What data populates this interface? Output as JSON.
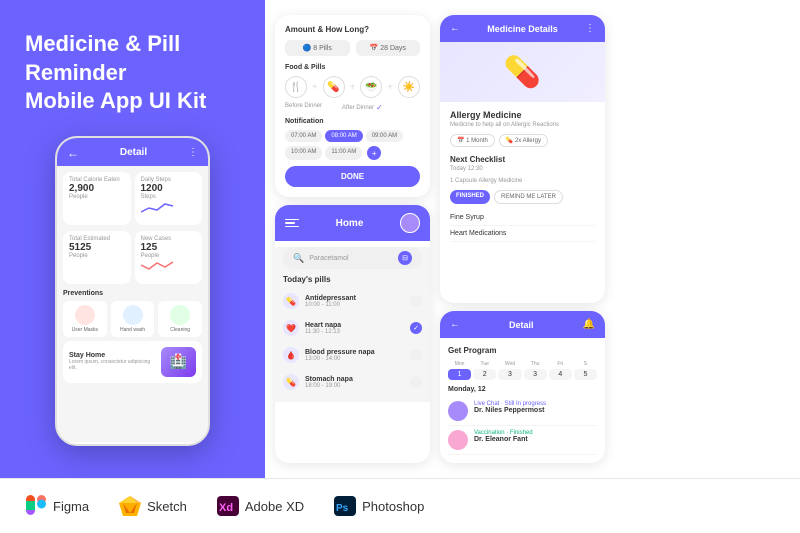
{
  "left": {
    "title": "Medicine & Pill Reminder\nMobile App UI Kit",
    "phone": {
      "header": "Detail",
      "stats": [
        {
          "label": "Total Calorie Eaten",
          "value": "2,900",
          "unit": "People"
        },
        {
          "label": "Daily Steps",
          "value": "1200",
          "unit": "Steps"
        }
      ],
      "stats2": [
        {
          "label": "Total Estimated",
          "value": "5125",
          "unit": "People"
        },
        {
          "label": "New Cases",
          "value": "125",
          "unit": "People"
        }
      ],
      "preventions_title": "Preventions",
      "preventions": [
        {
          "label": "User Masks"
        },
        {
          "label": "Hand wash"
        },
        {
          "label": "Cleaning"
        }
      ],
      "stay_home_title": "Stay Home",
      "stay_home_desc": "Lorem ipsum, consectetur adipiscing elit."
    }
  },
  "middle": {
    "amount_screen": {
      "title": "Amount & How Long?",
      "pill_amount": "8 Pills",
      "duration": "28 Days",
      "food_section": "Food & Pills",
      "before_dinner": "Before Dinner",
      "after_dinner": "After Dinner",
      "notification": "Notification",
      "times": [
        "07:00 AM",
        "08:00 AM",
        "09:00 AM",
        "10:00 AM",
        "11:00 AM"
      ],
      "done_btn": "DONE"
    },
    "home_screen": {
      "title": "Home",
      "search_placeholder": "Paracetamol",
      "today_pills": "Today's pills",
      "pills": [
        {
          "name": "Antidepressant",
          "time": "10:00 - 11:00",
          "checked": false
        },
        {
          "name": "Heart napa",
          "time": "11:30 - 12:13",
          "checked": true
        },
        {
          "name": "Blood pressure napa",
          "time": "13:00 - 14:00",
          "checked": false
        },
        {
          "name": "Stomach napa",
          "time": "18:00 - 19:00",
          "checked": false
        }
      ]
    }
  },
  "right": {
    "medicine_details": {
      "title": "Medicine Details",
      "image_emoji": "💊",
      "allergy_title": "Allergy Medicine",
      "allergy_desc": "Medicine to help all on Allergic Reactions",
      "tags": [
        "1 Month",
        "2x Allergy"
      ],
      "next_checklist": "Next Checklist",
      "time": "Today 12:30",
      "person": "1 Capsule Allergy Medicine",
      "btn_finished": "FINISHED",
      "btn_remind": "REMIND ME LATER",
      "items": [
        "Fine Syrup",
        "Heart Medications"
      ]
    },
    "detail_screen": {
      "title": "Detail",
      "get_program": "Get Program",
      "days": [
        {
          "label": "Mon",
          "num": "1",
          "active": true
        },
        {
          "label": "Tue",
          "num": "2",
          "active": false
        },
        {
          "label": "Wed",
          "num": "3",
          "active": false
        },
        {
          "label": "Thu",
          "num": "3",
          "active": false
        },
        {
          "label": "Fri",
          "num": "4",
          "active": false
        },
        {
          "label": "S",
          "num": "5",
          "active": false
        }
      ],
      "monday_label": "Monday, 12",
      "schedule_items": [
        {
          "type": "Live Chat · Still In progress",
          "name": "Dr. Niles Peppermost",
          "avatar_color": "#a78bfa"
        },
        {
          "type": "Vaccination · Finished",
          "name": "Dr. Eleanor Fant",
          "avatar_color": "#f9a8d4"
        }
      ]
    }
  },
  "bottom": {
    "tools": [
      {
        "name": "Figma",
        "icon": "figma"
      },
      {
        "name": "Sketch",
        "icon": "sketch"
      },
      {
        "name": "Adobe XD",
        "icon": "xd"
      },
      {
        "name": "Photoshop",
        "icon": "ps"
      }
    ]
  }
}
